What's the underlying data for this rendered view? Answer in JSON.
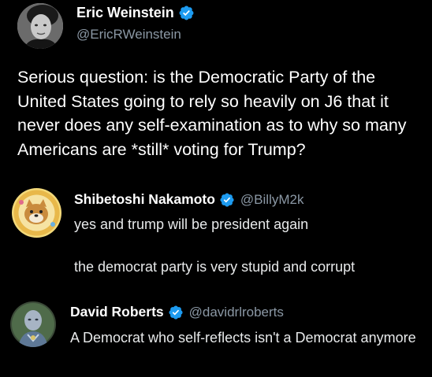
{
  "main_tweet": {
    "author_name": "Eric Weinstein",
    "handle": "@EricRWeinstein",
    "text": "Serious question: is the Democratic Party of the United States going to rely so heavily on J6 that it never does any self-examination as to why so many Americans are *still* voting for Trump?"
  },
  "replies": [
    {
      "author_name": "Shibetoshi Nakamoto",
      "handle": "@BillyM2k",
      "lines": [
        "yes and trump will be president again",
        "the democrat party is very stupid and corrupt"
      ]
    },
    {
      "author_name": "David Roberts",
      "handle": "@davidrlroberts",
      "lines": [
        "A Democrat who self-reflects isn't a Democrat anymore"
      ]
    }
  ],
  "colors": {
    "background": "#000000",
    "verified_badge": "#1d9bf0",
    "secondary_text": "#8b98a5"
  },
  "icons": {
    "verified": "verified-badge-icon"
  }
}
